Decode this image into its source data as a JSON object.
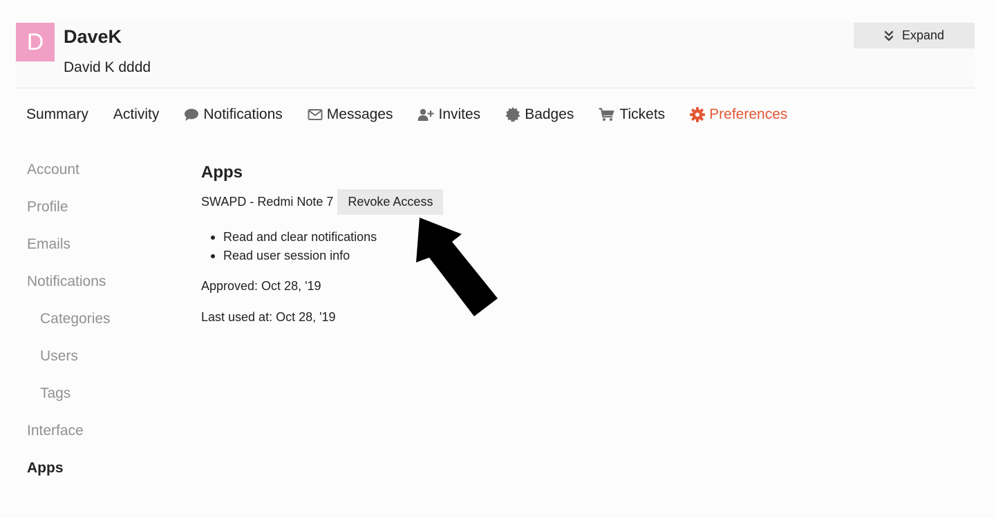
{
  "header": {
    "avatar_letter": "D",
    "avatar_color": "#f29fc6",
    "username": "DaveK",
    "full_name": "David K dddd",
    "expand_label": "Expand"
  },
  "nav": {
    "active_color": "#e45735",
    "items": [
      {
        "label": "Summary",
        "icon": ""
      },
      {
        "label": "Activity",
        "icon": ""
      },
      {
        "label": "Notifications",
        "icon": "comment-icon"
      },
      {
        "label": "Messages",
        "icon": "envelope-icon"
      },
      {
        "label": "Invites",
        "icon": "user-plus-icon"
      },
      {
        "label": "Badges",
        "icon": "certificate-icon"
      },
      {
        "label": "Tickets",
        "icon": "cart-icon"
      },
      {
        "label": "Preferences",
        "icon": "gear-icon",
        "active": true
      }
    ]
  },
  "sidebar": {
    "items": [
      {
        "label": "Account"
      },
      {
        "label": "Profile"
      },
      {
        "label": "Emails"
      },
      {
        "label": "Notifications"
      },
      {
        "label": "Categories"
      },
      {
        "label": "Users"
      },
      {
        "label": "Tags"
      },
      {
        "label": "Interface"
      },
      {
        "label": "Apps",
        "active": true
      }
    ]
  },
  "apps": {
    "title": "Apps",
    "app_name": "SWAPD - Redmi Note 7",
    "revoke_label": "Revoke Access",
    "scopes": [
      "Read and clear notifications",
      "Read user session info"
    ],
    "approved": "Approved: Oct 28, '19",
    "last_used": "Last used at: Oct 28, '19"
  },
  "annotation": {
    "arrow_icon": "arrow-pointer-icon",
    "arrow_color": "#000000"
  }
}
